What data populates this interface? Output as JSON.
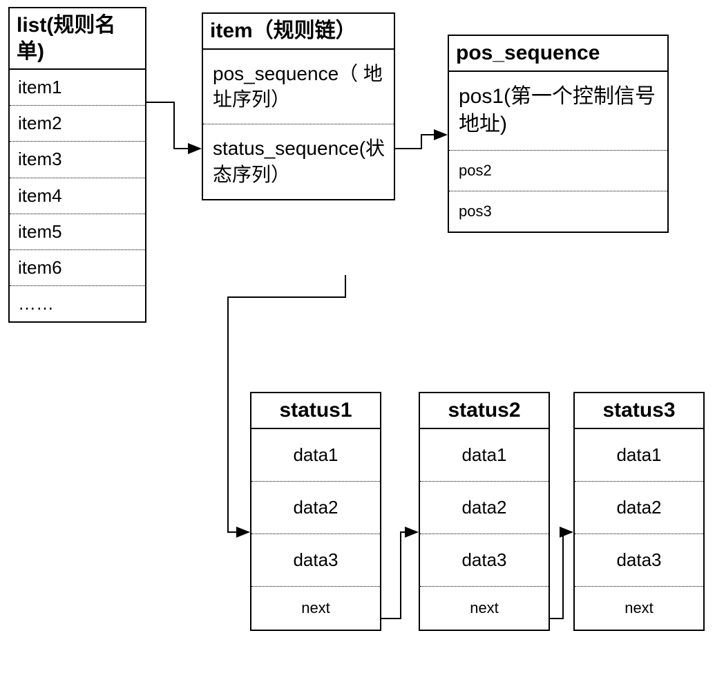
{
  "list_box": {
    "title": "list(规则名单)",
    "rows": [
      "item1",
      "item2",
      "item3",
      "item4",
      "item5",
      "item6",
      "……"
    ]
  },
  "item_box": {
    "title": "item（规则链）",
    "rows": [
      "pos_sequence（ 地址序列）",
      "status_sequence(状态序列）"
    ]
  },
  "pos_box": {
    "title": "pos_sequence",
    "first": "pos1(第一个控制信号地址)",
    "rest": [
      "pos2",
      "pos3"
    ]
  },
  "status_boxes": [
    {
      "title": "status1",
      "rows": [
        "data1",
        "data2",
        "data3",
        "next"
      ]
    },
    {
      "title": "status2",
      "rows": [
        "data1",
        "data2",
        "data3",
        "next"
      ]
    },
    {
      "title": "status3",
      "rows": [
        "data1",
        "data2",
        "data3",
        "next"
      ]
    }
  ]
}
